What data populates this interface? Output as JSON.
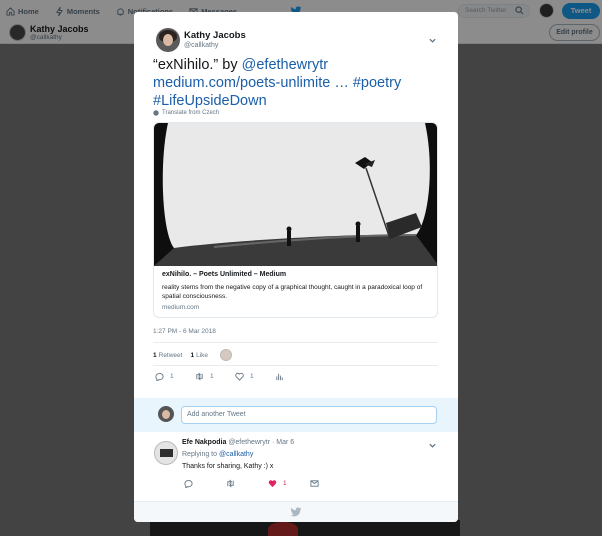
{
  "topbar": {
    "nav": [
      {
        "label": "Home",
        "icon": "home-icon"
      },
      {
        "label": "Moments",
        "icon": "lightning-icon"
      },
      {
        "label": "Notifications",
        "icon": "bell-icon"
      },
      {
        "label": "Messages",
        "icon": "envelope-icon"
      }
    ],
    "search_placeholder": "Search Twitter",
    "tweet_button": "Tweet"
  },
  "profile": {
    "name": "Kathy Jacobs",
    "handle": "@callkathy",
    "edit_button": "Edit profile"
  },
  "tweet": {
    "author_name": "Kathy Jacobs",
    "author_handle": "@callkathy",
    "text_plain": "“exNihilo.” by ",
    "text_mention": "@efethewrytr",
    "text_link": "medium.com/poets-unlimite …",
    "text_hashtag1": "#poetry",
    "text_hashtag2": "#LifeUpsideDown",
    "translate_label": "Translate from Czech",
    "card": {
      "title": "exNihilo. – Poets Unlimited – Medium",
      "description": "reality stems from the negative copy of a graphical thought, caught in a paradoxical loop of spatial consciousness.",
      "domain": "medium.com"
    },
    "timestamp": "1:27 PM - 6 Mar 2018",
    "retweets_count": "1",
    "retweets_label": "Retweet",
    "likes_count": "1",
    "likes_label": "Like",
    "actions": {
      "reply_count": "1",
      "retweet_count": "1",
      "like_count": "1"
    }
  },
  "reply_box": {
    "placeholder": "Add another Tweet"
  },
  "reply": {
    "author_name": "Efe Nakpodia",
    "author_handle": "@efethewrytr",
    "date": "· Mar 6",
    "replying_prefix": "Replying to",
    "replying_to": "@callkathy",
    "text": "Thanks for sharing, Kathy :) x",
    "like_count": "1"
  },
  "colors": {
    "accent": "#1da1f2",
    "link": "#1b5ea9",
    "like": "#e0245e"
  }
}
